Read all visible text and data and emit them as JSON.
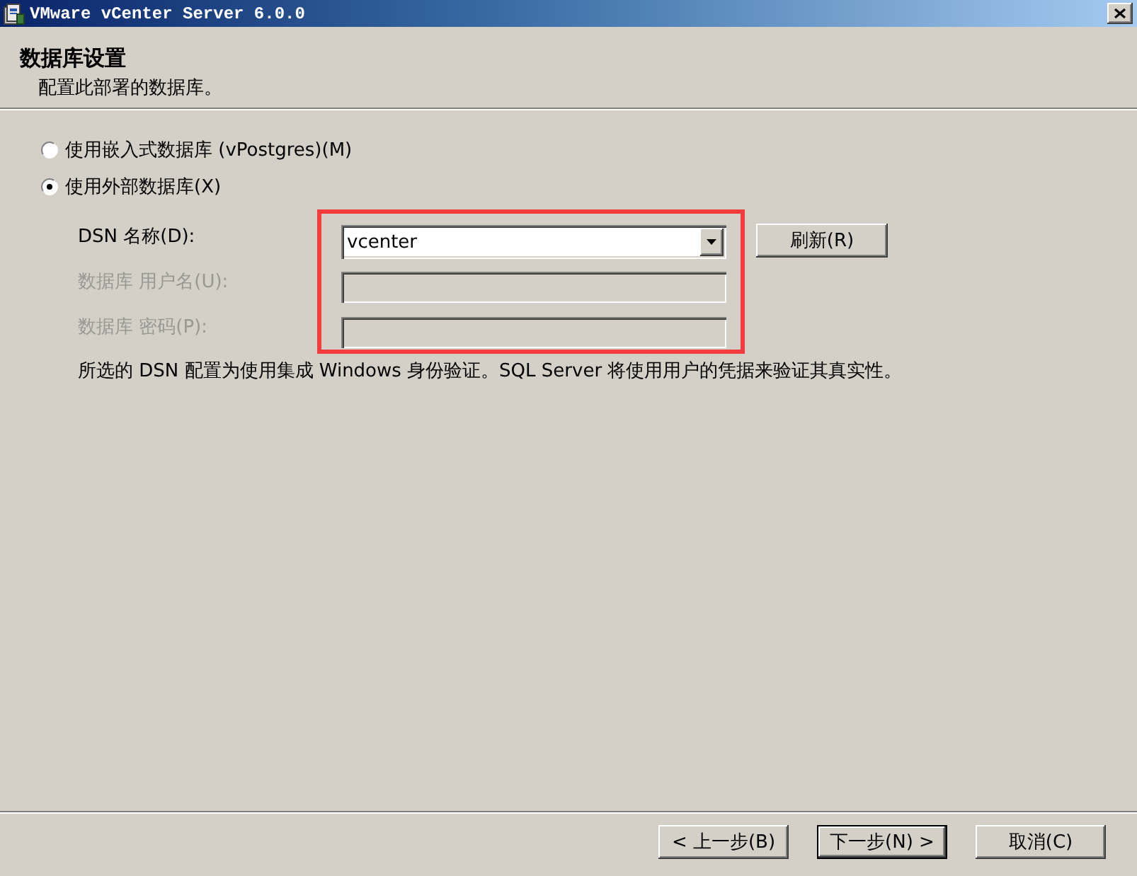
{
  "window": {
    "title": "VMware vCenter Server 6.0.0"
  },
  "header": {
    "title": "数据库设置",
    "subtitle": "配置此部署的数据库。"
  },
  "database_options": [
    {
      "label": "使用嵌入式数据库 (vPostgres)(M)",
      "selected": false
    },
    {
      "label": "使用外部数据库(X)",
      "selected": true
    }
  ],
  "form": {
    "rows": [
      {
        "kind": "dropdown",
        "label": "DSN 名称(D):",
        "value": "vcenter",
        "disabled": false
      },
      {
        "kind": "text",
        "label": "数据库 用户名(U):",
        "disabled": true
      },
      {
        "kind": "password",
        "label": "数据库 密码(P):",
        "disabled": true
      }
    ],
    "refresh_button": "刷新(R)",
    "note": "所选的 DSN 配置为使用集成 Windows 身份验证。SQL Server 将使用用户的凭据来验证其真实性。"
  },
  "buttons": [
    {
      "label": "< 上一步(B)",
      "default": false
    },
    {
      "label": "下一步(N) >",
      "default": true
    },
    {
      "label": "取消(C)",
      "default": false
    }
  ]
}
